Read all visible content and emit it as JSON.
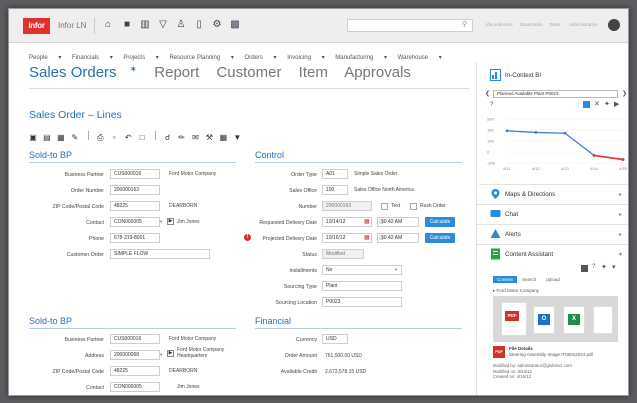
{
  "topbar": {
    "logo": "infor",
    "app_name": "Infor LN",
    "search_placeholder": "",
    "links": [
      "Ida Andersen",
      "Bookmarks",
      "Tasks",
      "Administration"
    ]
  },
  "menu": [
    "People",
    "Financials",
    "Projects",
    "Resource Planning",
    "Orders",
    "Invoicing",
    "Manufacturing",
    "Warehouse"
  ],
  "tabs": [
    "Sales Orders",
    "Report",
    "Customer",
    "Item",
    "Approvals"
  ],
  "tab_active_marker": "✶",
  "section_title": "Sales Order – Lines",
  "sold_to_bp": {
    "title": "Sold-to BP",
    "business_partner_label": "Business Partner",
    "business_partner": "CUS000016",
    "business_partner_name": "Ford Motor Company",
    "order_number_label": "Order Number",
    "order_number": "200000163",
    "zip_label": "ZIP Code/Postal Code",
    "zip": "48225",
    "city": "DEARBORN",
    "contact_label": "Contact",
    "contact": "CON000005",
    "contact_name": "Jim Jones",
    "phone_label": "Phone",
    "phone": "678-319-8001",
    "customer_order_label": "Customer Order",
    "customer_order": "SIMPLE FLOW"
  },
  "control": {
    "title": "Control",
    "order_type_label": "Order Type",
    "order_type": "A01",
    "order_type_desc": "Simple Sales Order",
    "sales_office_label": "Sales Office",
    "sales_office": "100",
    "sales_office_desc": "Sales Office North America",
    "number_label": "Number",
    "number": "200000163",
    "text_label": "Text",
    "rush_label": "Rush Order",
    "req_date_label": "Requested Delivery Date",
    "req_date": "10/14/12",
    "req_time": "10:42 AM",
    "proj_date_label": "Projected Delivery Date",
    "proj_date": "10/16/12",
    "proj_time": "10:42 AM",
    "calculate": "Calculate",
    "status_label": "Status",
    "status": "Modified",
    "installments_label": "Installments",
    "installments": "No",
    "sourcing_type_label": "Sourcing Type",
    "sourcing_type": "Plant",
    "sourcing_location_label": "Sourcing Location",
    "sourcing_location": "P0023"
  },
  "sold_to_bp_2": {
    "title": "Sold-to BP",
    "business_partner_label": "Business Partner",
    "business_partner": "CUS000016",
    "business_partner_name": "Ford Motor Company",
    "address_label": "Address",
    "address": "200000068",
    "address_line1": "Ford Motor Company",
    "address_line2": "Headquarters",
    "zip_label": "ZIP Code/Postal Code",
    "zip": "48225",
    "city": "DEARBORN",
    "contact_label": "Contact",
    "contact": "CON000005",
    "contact_name": "Jim Jones"
  },
  "financial": {
    "title": "Financial",
    "currency_label": "Currency",
    "currency": "USD",
    "order_amount_label": "Order Amount",
    "order_amount": "761,500.00",
    "order_amount_ccy": "USD",
    "available_credit_label": "Available Credit",
    "available_credit": "2,673,578.15",
    "available_credit_ccy": "USD"
  },
  "right_panel": {
    "bi_title": "In-Context BI",
    "bi_select": "Planned Available Plant P0023",
    "maps_title": "Maps & Directions",
    "chat_title": "Chat",
    "alerts_title": "Alerts",
    "content_title": "Content Assistant",
    "content_tabs": [
      "Content",
      "Search",
      "Upload"
    ],
    "content_breadcrumb": "Ford Motor Company",
    "file_details_label": "File Details",
    "file_name": "Steering Assembly Image IT00012024.pdf",
    "modified_by": "Modified by: administrator@globinv2.com",
    "modified_on": "Modified on: 8/24/12",
    "created_on": "Created on: 4/16/12",
    "doc_labels": [
      "PDF",
      "O",
      "X"
    ]
  },
  "chart_data": {
    "type": "line",
    "categories": [
      "4/11",
      "4/12",
      "4/13",
      "4/14",
      "4/15"
    ],
    "series": [
      {
        "values": [
          130,
          120,
          115,
          -20,
          -45
        ],
        "color": "#3b7fd1"
      },
      {
        "values": [
          null,
          null,
          null,
          -20,
          -45
        ],
        "color": "#e23a2a"
      }
    ],
    "yticks": [
      200,
      150,
      100,
      0,
      -200
    ],
    "ylim": [
      -60,
      220
    ]
  },
  "colors": {
    "accent": "#2a6fb6",
    "brand": "#e0322b",
    "button": "#2d8ad9"
  }
}
